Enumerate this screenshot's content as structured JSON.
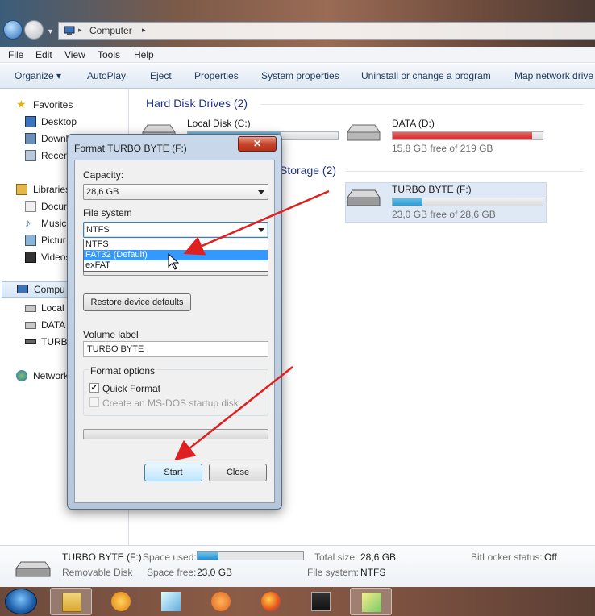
{
  "address": {
    "separator": "▸",
    "location": "Computer",
    "trail": "▸"
  },
  "menu": [
    "File",
    "Edit",
    "View",
    "Tools",
    "Help"
  ],
  "toolbar": [
    "Organize ▾",
    "AutoPlay",
    "Eject",
    "Properties",
    "System properties",
    "Uninstall or change a program",
    "Map network drive"
  ],
  "nav": {
    "favorites": "Favorites",
    "desktop": "Desktop",
    "downloads": "Downl",
    "recent": "Recen",
    "libraries": "Libraries",
    "documents": "Docur",
    "music": "Music",
    "pictures": "Pictur",
    "videos": "Videos",
    "computer": "Compu",
    "local": "Local",
    "data": "DATA",
    "turbo": "TURBO",
    "network": "Network"
  },
  "groups": {
    "hdd": "Hard Disk Drives (2)",
    "removable": "Storage (2)"
  },
  "drives": {
    "c": {
      "name": "Local Disk (C:)",
      "fill": 0.62,
      "color": "#26a0da"
    },
    "d": {
      "name": "DATA (D:)",
      "free": "15,8 GB free of 219 GB",
      "fill": 0.93,
      "color": "#da2626"
    },
    "f": {
      "name": "TURBO BYTE (F:)",
      "free": "23,0 GB free of 28,6 GB",
      "fill": 0.2,
      "color": "#26a0da"
    }
  },
  "details": {
    "name": "TURBO BYTE (F:)",
    "type": "Removable Disk",
    "space_used_label": "Space used:",
    "space_free_label": "Space free:",
    "space_free": "23,0 GB",
    "total_label": "Total size:",
    "total": "28,6 GB",
    "fs_label": "File system:",
    "fs": "NTFS",
    "bitlocker_label": "BitLocker status:",
    "bitlocker": "Off",
    "used_fill": 0.2
  },
  "dialog": {
    "title": "Format TURBO BYTE (F:)",
    "close": "✕",
    "capacity_label": "Capacity:",
    "capacity": "28,6 GB",
    "fs_label": "File system",
    "fs_value": "NTFS",
    "fs_options": [
      "NTFS",
      "FAT32 (Default)",
      "exFAT"
    ],
    "restore": "Restore device defaults",
    "volume_label": "Volume label",
    "volume": "TURBO BYTE",
    "format_options": "Format options",
    "quick": "Quick Format",
    "quick_checked": "✓",
    "msdos": "Create an MS-DOS startup disk",
    "start": "Start",
    "close_btn": "Close"
  }
}
